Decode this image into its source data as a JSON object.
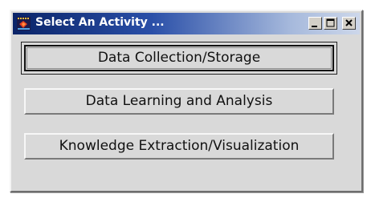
{
  "window": {
    "title": "Select An Activity ...",
    "icon": "app-icon"
  },
  "titlebar_controls": [
    {
      "name": "minimize-icon"
    },
    {
      "name": "maximize-icon"
    },
    {
      "name": "close-icon"
    }
  ],
  "buttons": [
    {
      "label": "Data Collection/Storage",
      "focused": true
    },
    {
      "label": "Data Learning and Analysis",
      "focused": false
    },
    {
      "label": "Knowledge Extraction/Visualization",
      "focused": false
    }
  ],
  "colors": {
    "titlebar_start": "#0a2468",
    "titlebar_end": "#cdd7ea",
    "window_bg": "#d9d9d9"
  }
}
